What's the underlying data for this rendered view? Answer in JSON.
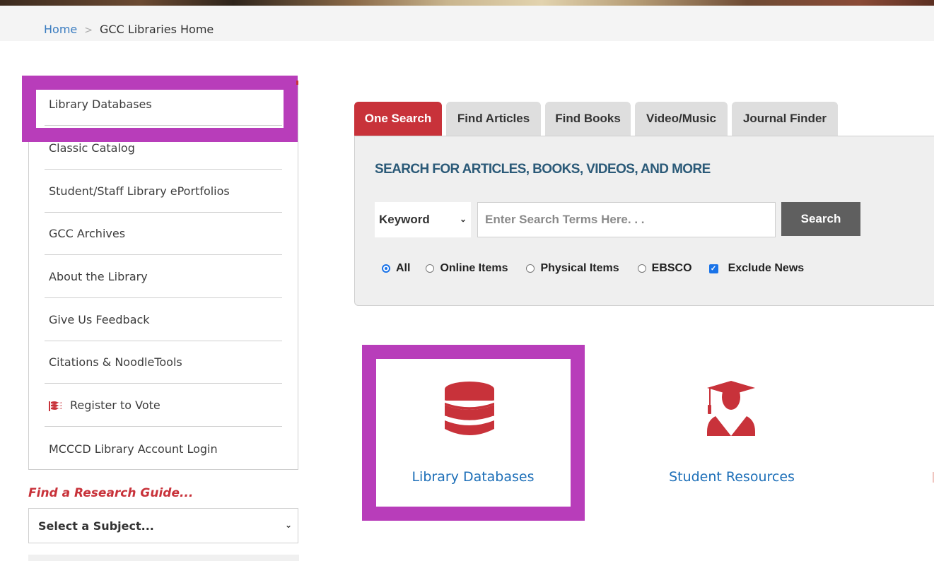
{
  "breadcrumb": {
    "home": "Home",
    "separator": ">",
    "current": "GCC Libraries Home"
  },
  "sidebar": {
    "items": [
      {
        "label": "Library Databases",
        "icon": null
      },
      {
        "label": "Classic Catalog",
        "icon": null
      },
      {
        "label": "Student/Staff Library ePortfolios",
        "icon": null
      },
      {
        "label": "GCC Archives",
        "icon": null
      },
      {
        "label": "About the Library",
        "icon": null
      },
      {
        "label": "Give Us Feedback",
        "icon": null
      },
      {
        "label": "Citations & NoodleTools",
        "icon": null
      },
      {
        "label": "Register to Vote",
        "icon": "flag-icon"
      },
      {
        "label": "MCCCD Library Account Login",
        "icon": null
      }
    ],
    "guide_title": "Find a Research Guide...",
    "subject_select": "Select a Subject..."
  },
  "search": {
    "tabs": [
      {
        "label": "One Search",
        "active": true
      },
      {
        "label": "Find Articles",
        "active": false
      },
      {
        "label": "Find Books",
        "active": false
      },
      {
        "label": "Video/Music",
        "active": false
      },
      {
        "label": "Journal Finder",
        "active": false
      }
    ],
    "heading": "SEARCH FOR ARTICLES, BOOKS, VIDEOS, AND MORE",
    "field_select": "Keyword",
    "input_placeholder": "Enter Search Terms Here. . .",
    "input_value": "",
    "button": "Search",
    "options": [
      {
        "label": "All",
        "type": "radio",
        "checked": true
      },
      {
        "label": "Online Items",
        "type": "radio",
        "checked": false
      },
      {
        "label": "Physical Items",
        "type": "radio",
        "checked": false
      },
      {
        "label": "EBSCO",
        "type": "radio",
        "checked": false
      },
      {
        "label": "Exclude News",
        "type": "checkbox",
        "checked": true
      }
    ]
  },
  "cards": [
    {
      "label": "Library Databases",
      "icon": "database-icon"
    },
    {
      "label": "Student Resources",
      "icon": "graduate-icon"
    }
  ],
  "colors": {
    "accent_red": "#c8323a",
    "highlight": "#b83dba",
    "link_blue": "#1d6fb8",
    "heading_blue": "#2b5a78"
  }
}
